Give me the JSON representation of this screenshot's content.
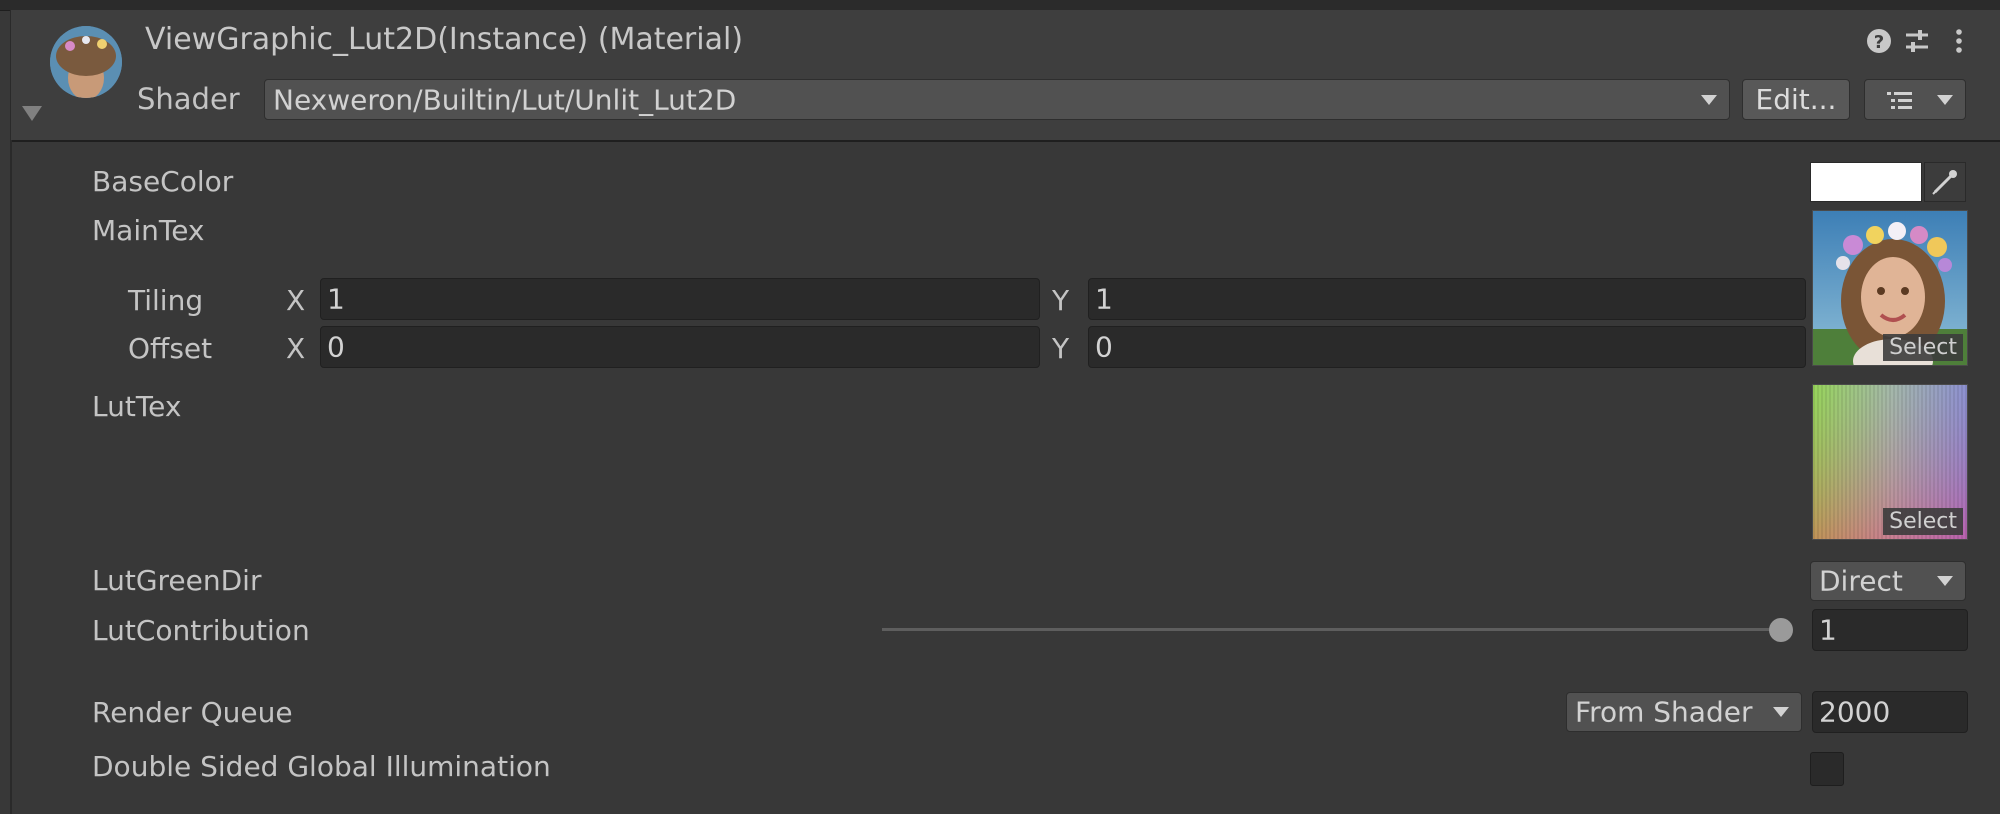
{
  "header": {
    "title": "ViewGraphic_Lut2D(Instance) (Material)",
    "help_icon": "help-icon",
    "presets_icon": "presets-icon",
    "menu_icon": "kebab-menu-icon",
    "shader_label": "Shader",
    "shader_value": "Nexweron/Builtin/Lut/Unlit_Lut2D",
    "edit_button": "Edit...",
    "list_button_icon": "list-icon"
  },
  "properties": {
    "base_color": {
      "label": "BaseColor",
      "value": "#FFFFFF",
      "picker_icon": "eyedropper-icon"
    },
    "main_tex": {
      "label": "MainTex",
      "tiling_label": "Tiling",
      "offset_label": "Offset",
      "x_label": "X",
      "y_label": "Y",
      "tiling_x": "1",
      "tiling_y": "1",
      "offset_x": "0",
      "offset_y": "0",
      "select_label": "Select"
    },
    "lut_tex": {
      "label": "LutTex",
      "select_label": "Select"
    },
    "lut_green_dir": {
      "label": "LutGreenDir",
      "value": "Direct"
    },
    "lut_contribution": {
      "label": "LutContribution",
      "value": "1",
      "slider_fraction": 1.0
    },
    "render_queue": {
      "label": "Render Queue",
      "mode": "From Shader",
      "value": "2000"
    },
    "double_sided_gi": {
      "label": "Double Sided Global Illumination",
      "checked": false
    }
  },
  "colors": {
    "background": "#383838",
    "header": "#3E3E3E",
    "field": "#2A2A2A",
    "text": "#C4C4C4"
  }
}
